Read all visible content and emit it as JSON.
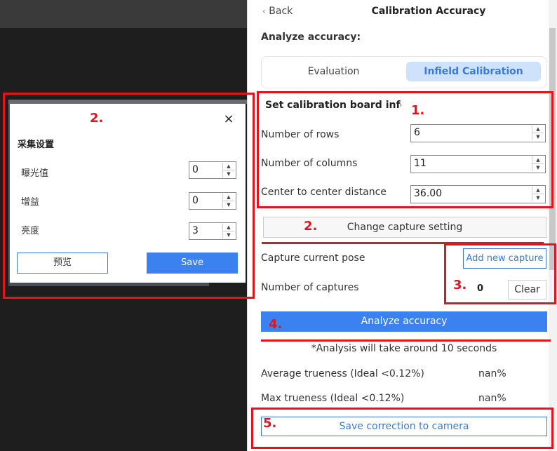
{
  "dialog": {
    "close_glyph": "×",
    "title": "采集设置",
    "fields": [
      {
        "label": "曝光值",
        "value": "0"
      },
      {
        "label": "增益",
        "value": "0"
      },
      {
        "label": "亮度",
        "value": "3"
      }
    ],
    "preview_label": "预览",
    "save_label": "Save"
  },
  "panel": {
    "back_label": "Back",
    "title": "Calibration Accuracy",
    "analyze_label": "Analyze accuracy:",
    "tabs": [
      {
        "label": "Evaluation",
        "selected": false
      },
      {
        "label": "Infield Calibration",
        "selected": true
      }
    ],
    "board_title": "Set calibration board info",
    "board_fields": [
      {
        "label": "Number of rows",
        "value": "6"
      },
      {
        "label": "Number of columns",
        "value": "11"
      },
      {
        "label": "Center to center distance",
        "value": "36.00"
      }
    ],
    "change_capture_label": "Change capture setting",
    "capture_pose_label": "Capture current pose",
    "add_capture_label": "Add new capture",
    "num_captures_label": "Number of captures",
    "num_captures_value": "0",
    "clear_label": "Clear",
    "analyze_button_label": "Analyze accuracy",
    "analysis_note": "*Analysis will take around 10 seconds",
    "avg_trueness_label": "Average trueness (Ideal <0.12%)",
    "avg_trueness_value": "nan%",
    "max_trueness_label": "Max trueness (Ideal <0.12%)",
    "max_trueness_value": "nan%",
    "save_correction_label": "Save correction to camera"
  },
  "annotations": {
    "n1": "1.",
    "n2_dialog": "2.",
    "n2_panel": "2.",
    "n3": "3.",
    "n4": "4.",
    "n5": "5."
  },
  "colors": {
    "accent": "#3b82f0",
    "annotation_red": "#e0161e",
    "tab_selected_bg": "#cfe2fb"
  }
}
